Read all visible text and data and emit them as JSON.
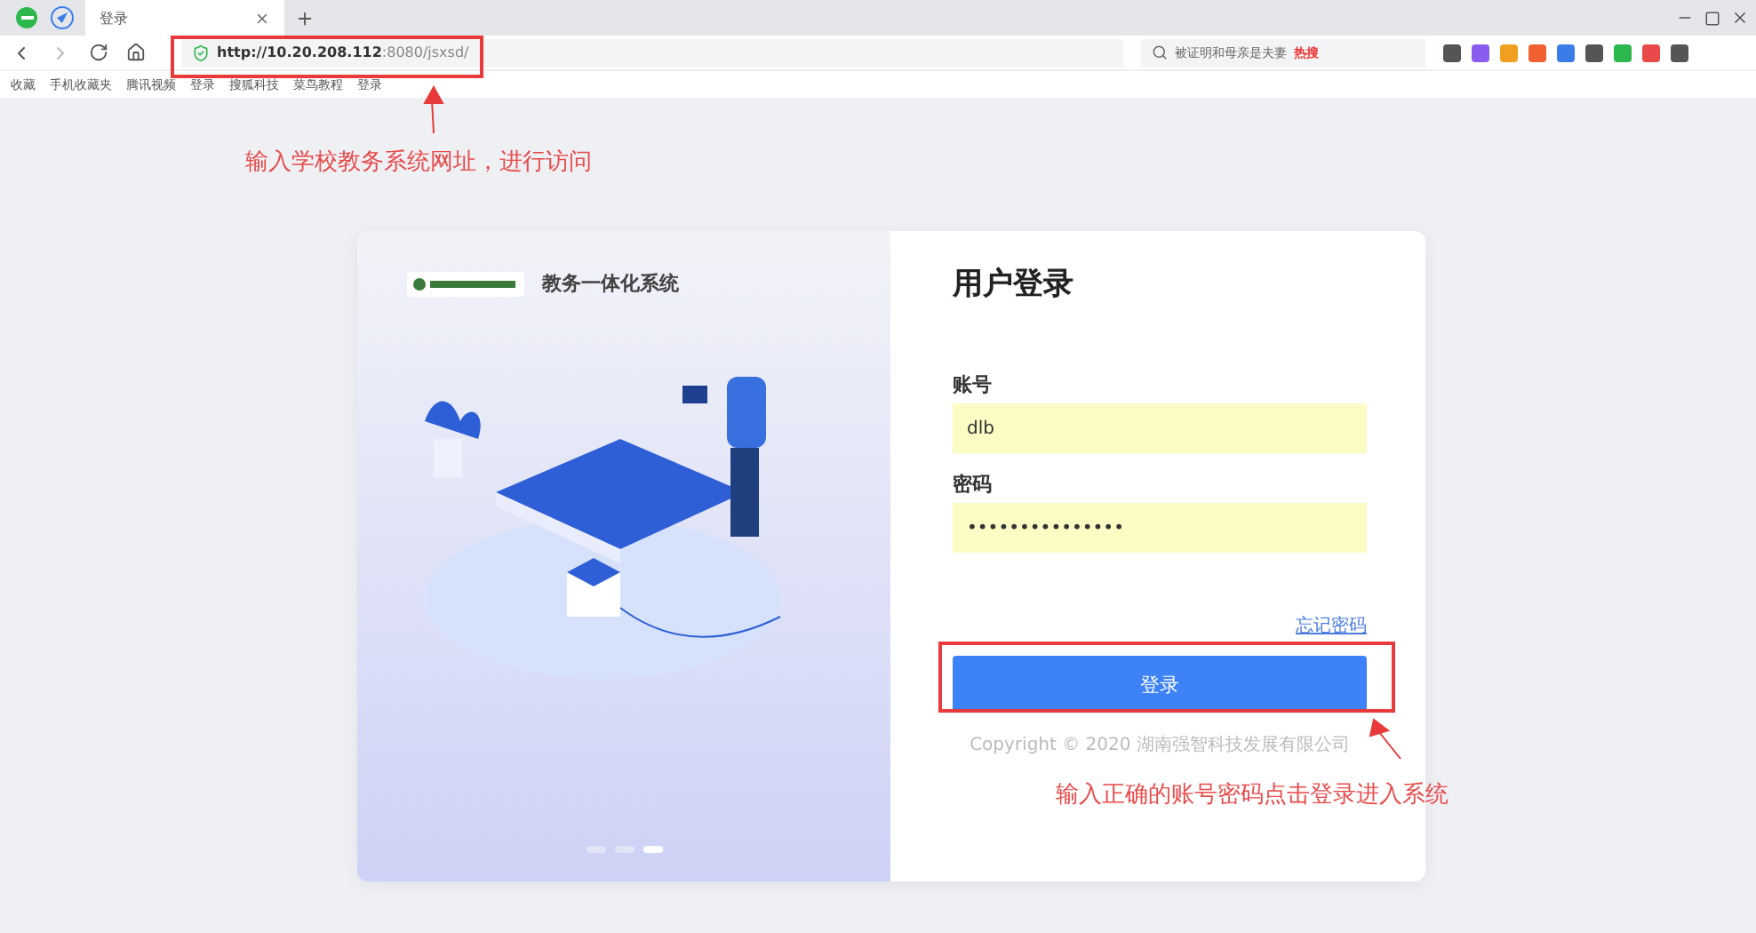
{
  "browser": {
    "tabs": [
      {
        "label": "登录",
        "selected": true
      }
    ],
    "url": {
      "host": "http://10.20.208.112",
      "rest": ":8080/jsxsd/"
    },
    "search": {
      "placeholder": "被证明和母亲是夫妻",
      "hot": "热搜"
    },
    "bookmarks": [
      {
        "label": "收藏"
      },
      {
        "label": "手机收藏夹"
      },
      {
        "label": "腾讯视频"
      },
      {
        "label": "登录"
      },
      {
        "label": "搜狐科技"
      },
      {
        "label": "菜鸟教程"
      },
      {
        "label": "登录"
      }
    ]
  },
  "login": {
    "system_name": "教务一体化系统",
    "title": "用户登录",
    "fields": [
      {
        "label": "账号",
        "value": "dlb"
      },
      {
        "label": "密码",
        "value": "•••••••••••••••"
      }
    ],
    "forgot": "忘记密码",
    "submit": "登录",
    "copyright": "Copyright © 2020 湖南强智科技发展有限公司",
    "slides": [
      {
        "selected": false
      },
      {
        "selected": false
      },
      {
        "selected": true
      }
    ]
  },
  "annotations": [
    {
      "text": "输入学校教务系统网址，进行访问"
    },
    {
      "text": "输入正确的账号密码点击登录进入系统"
    }
  ]
}
